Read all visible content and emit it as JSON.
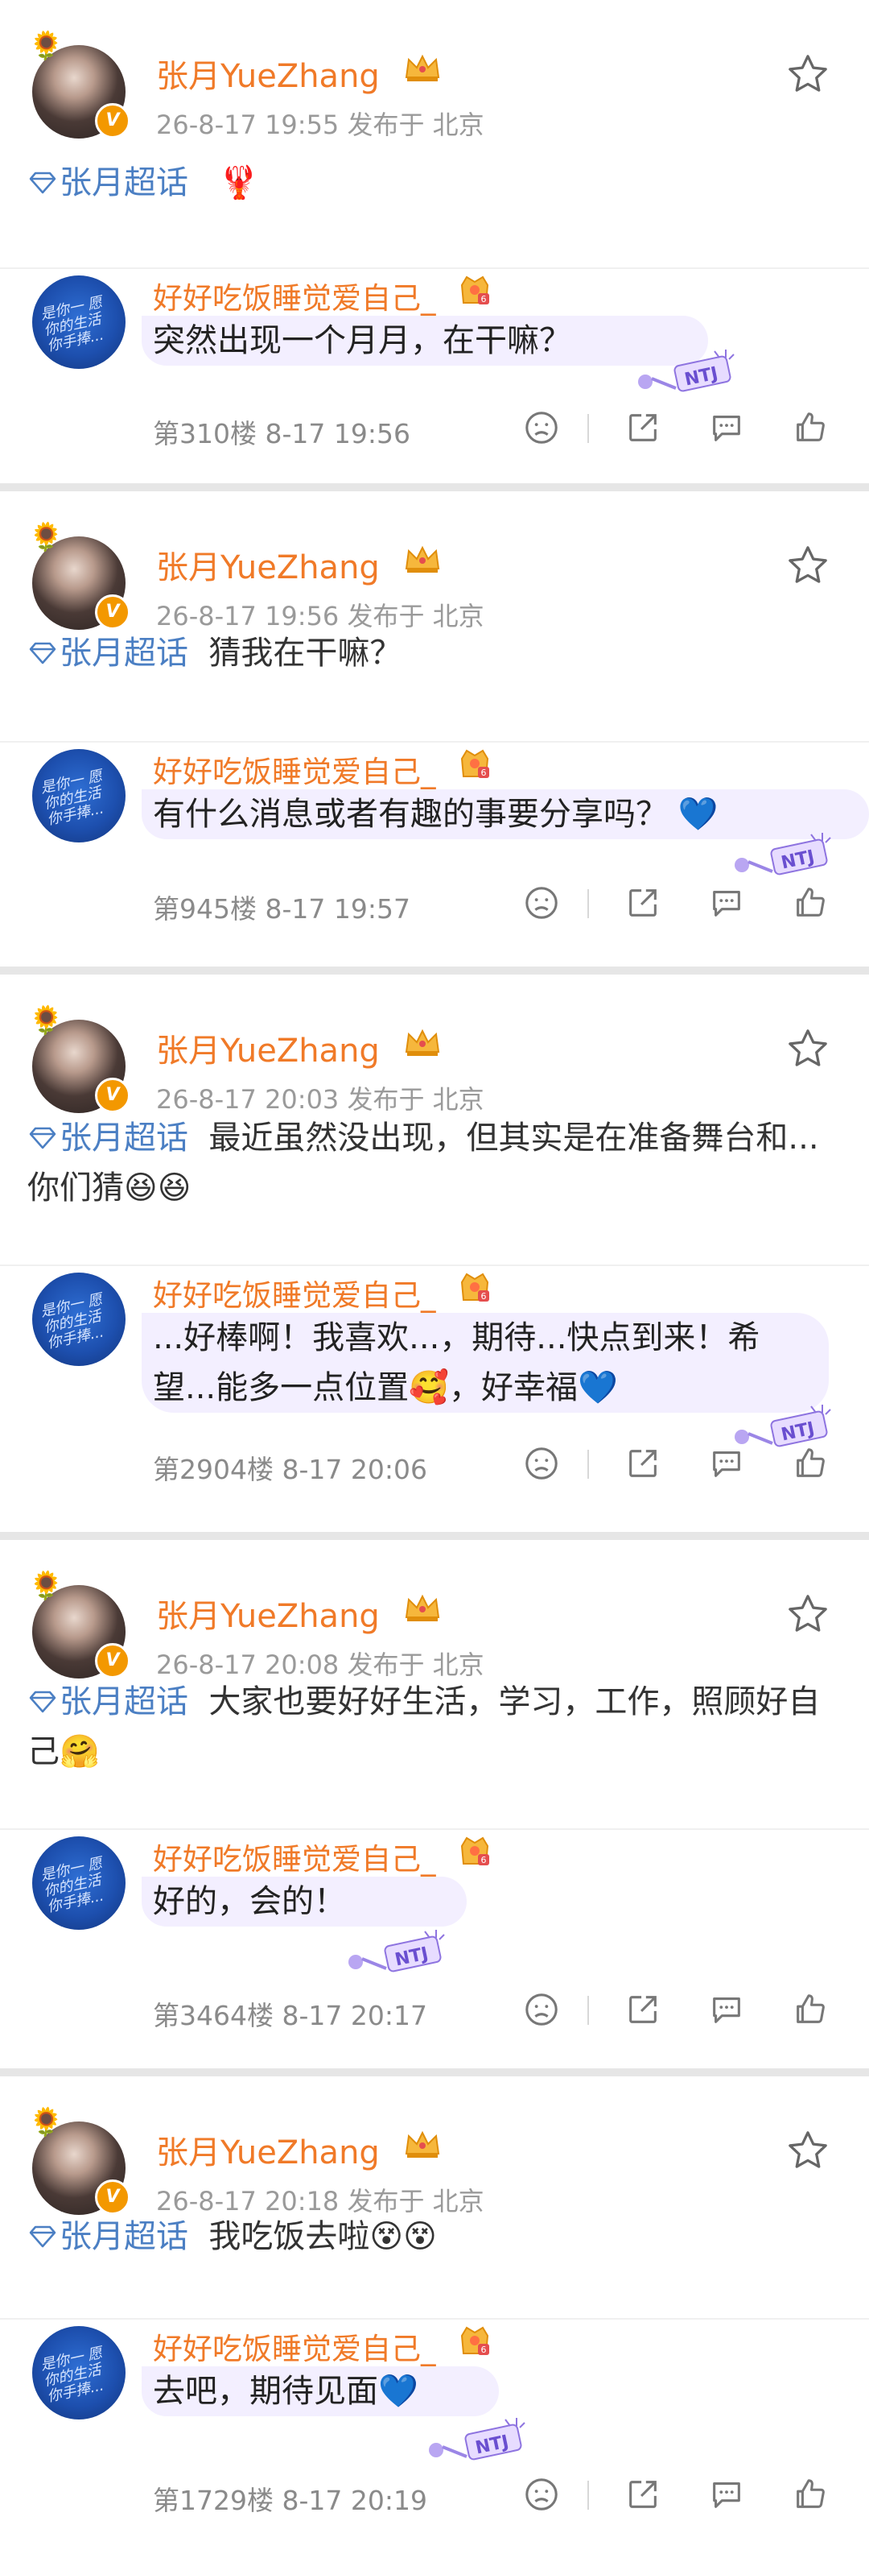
{
  "author_name": "张月YueZhang",
  "meta_location": "发布于 北京",
  "topic": "张月超话",
  "commenter_name": "好好吃饭睡觉爱自己_",
  "commenter_badge": "6",
  "verified_mark": "V",
  "commenter_avatar_text": "是你一 愿你的生活 你手捧...",
  "icons": {
    "flower": "sunflower-icon",
    "crown": "crown-icon",
    "star": "star-icon",
    "topic": "diamond-icon",
    "actions": [
      "sad-face-icon",
      "share-icon",
      "comment-icon",
      "like-icon"
    ],
    "sticker": "ntj-sticker"
  },
  "colors": {
    "author": "#f07a28",
    "topic": "#4b7fc3",
    "bubble": "#f3efff",
    "meta": "#9a9a9a",
    "divider": "#e6e6e6"
  },
  "posts": [
    {
      "time": "26-8-17 19:55",
      "post_text": "",
      "post_emoji": "🦞",
      "comment_lines": [
        "突然出现一个月月，在干嘛？"
      ],
      "floor": "第310楼 8-17 19:56"
    },
    {
      "time": "26-8-17 19:56",
      "post_text": "猜我在干嘛？",
      "post_emoji": "",
      "comment_lines": [
        "有什么消息或者有趣的事要分享吗？ 💙"
      ],
      "floor": "第945楼 8-17 19:57"
    },
    {
      "time": "26-8-17 20:03",
      "post_text_lines": [
        "最近虽然没出现，但其实是在准备舞",
        "台和...你们猜😆😆"
      ],
      "comment_lines": [
        "...好棒啊！我喜欢...，期待...快点到来！希",
        "望...能多一点位置🥰，好幸福💙"
      ],
      "floor": "第2904楼 8-17 20:06"
    },
    {
      "time": "26-8-17 20:08",
      "post_text_lines": [
        "大家也要好好生活，学习，工作，照",
        "顾好自己🤗"
      ],
      "comment_lines": [
        "好的，会的！"
      ],
      "floor": "第3464楼 8-17 20:17"
    },
    {
      "time": "26-8-17 20:18",
      "post_text": "我吃饭去啦😵😵",
      "post_emoji": "",
      "comment_lines": [
        "去吧，期待见面💙"
      ],
      "floor": "第1729楼 8-17 20:19"
    }
  ]
}
